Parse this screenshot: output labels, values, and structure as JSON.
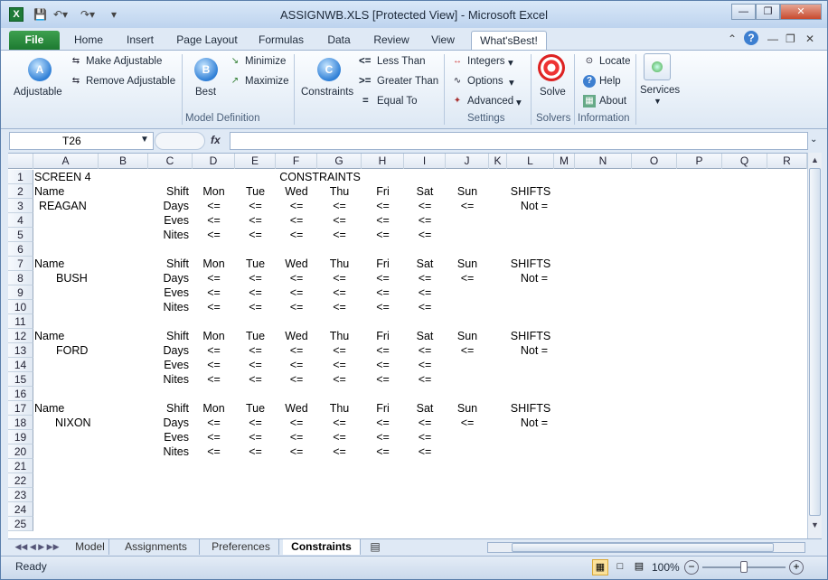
{
  "window": {
    "title": "ASSIGNWB.XLS  [Protected View]  -  Microsoft Excel",
    "app_icon": "X"
  },
  "quick_access": {
    "save": "save-icon",
    "undo": "undo-icon",
    "redo": "redo-icon"
  },
  "tabs": [
    "File",
    "Home",
    "Insert",
    "Page Layout",
    "Formulas",
    "Data",
    "Review",
    "View",
    "What'sBest!"
  ],
  "ribbon": {
    "adjustable": "Adjustable",
    "make_adjustable": "Make Adjustable",
    "remove_adjustable": "Remove Adjustable",
    "best": "Best",
    "minimize": "Minimize",
    "maximize": "Maximize",
    "constraints": "Constraints",
    "less_than": "Less Than",
    "greater_than": "Greater Than",
    "equal_to": "Equal To",
    "integers": "Integers",
    "options": "Options",
    "advanced": "Advanced",
    "solve": "Solve",
    "locate": "Locate",
    "help": "Help",
    "about": "About",
    "services": "Services",
    "groups": {
      "model_definition": "Model Definition",
      "settings": "Settings",
      "solvers": "Solvers",
      "information": "Information"
    },
    "glyphs": {
      "le": "<=",
      "ge": ">=",
      "eq": "="
    }
  },
  "formula_bar": {
    "name_box": "T26",
    "fx": "fx",
    "value": ""
  },
  "columns": [
    "A",
    "B",
    "C",
    "D",
    "E",
    "F",
    "G",
    "H",
    "I",
    "J",
    "K",
    "L",
    "M",
    "N",
    "O",
    "P",
    "Q",
    "R"
  ],
  "rows": [
    "1",
    "2",
    "3",
    "4",
    "5",
    "6",
    "7",
    "8",
    "9",
    "10",
    "11",
    "12",
    "13",
    "14",
    "15",
    "16",
    "17",
    "18",
    "19",
    "20",
    "21",
    "22",
    "23",
    "24",
    "25"
  ],
  "cells": {
    "A1": "SCREEN 4",
    "F1": "CONSTRAINTS",
    "A2": "Name",
    "C2": "Shift",
    "D2": "Mon",
    "E2": "Tue",
    "F2": "Wed",
    "G2": "Thu",
    "H2": "Fri",
    "I2": "Sat",
    "J2": "Sun",
    "L2": "SHIFTS",
    "A3": "REAGAN",
    "C3": "Days",
    "D3": "<=",
    "E3": "<=",
    "F3": "<=",
    "G3": "<=",
    "H3": "<=",
    "I3": "<=",
    "J3": "<=",
    "L3": "Not =",
    "C4": "Eves",
    "D4": "<=",
    "E4": "<=",
    "F4": "<=",
    "G4": "<=",
    "H4": "<=",
    "I4": "<=",
    "C5": "Nites",
    "D5": "<=",
    "E5": "<=",
    "F5": "<=",
    "G5": "<=",
    "H5": "<=",
    "I5": "<=",
    "A7": "Name",
    "C7": "Shift",
    "D7": "Mon",
    "E7": "Tue",
    "F7": "Wed",
    "G7": "Thu",
    "H7": "Fri",
    "I7": "Sat",
    "J7": "Sun",
    "L7": "SHIFTS",
    "A8": "BUSH",
    "C8": "Days",
    "D8": "<=",
    "E8": "<=",
    "F8": "<=",
    "G8": "<=",
    "H8": "<=",
    "I8": "<=",
    "J8": "<=",
    "L8": "Not =",
    "C9": "Eves",
    "D9": "<=",
    "E9": "<=",
    "F9": "<=",
    "G9": "<=",
    "H9": "<=",
    "I9": "<=",
    "C10": "Nites",
    "D10": "<=",
    "E10": "<=",
    "F10": "<=",
    "G10": "<=",
    "H10": "<=",
    "I10": "<=",
    "A12": "Name",
    "C12": "Shift",
    "D12": "Mon",
    "E12": "Tue",
    "F12": "Wed",
    "G12": "Thu",
    "H12": "Fri",
    "I12": "Sat",
    "J12": "Sun",
    "L12": "SHIFTS",
    "A13": "FORD",
    "C13": "Days",
    "D13": "<=",
    "E13": "<=",
    "F13": "<=",
    "G13": "<=",
    "H13": "<=",
    "I13": "<=",
    "J13": "<=",
    "L13": "Not =",
    "C14": "Eves",
    "D14": "<=",
    "E14": "<=",
    "F14": "<=",
    "G14": "<=",
    "H14": "<=",
    "I14": "<=",
    "C15": "Nites",
    "D15": "<=",
    "E15": "<=",
    "F15": "<=",
    "G15": "<=",
    "H15": "<=",
    "I15": "<=",
    "A17": "Name",
    "C17": "Shift",
    "D17": "Mon",
    "E17": "Tue",
    "F17": "Wed",
    "G17": "Thu",
    "H17": "Fri",
    "I17": "Sat",
    "J17": "Sun",
    "L17": "SHIFTS",
    "A18": "NIXON",
    "C18": "Days",
    "D18": "<=",
    "E18": "<=",
    "F18": "<=",
    "G18": "<=",
    "H18": "<=",
    "I18": "<=",
    "J18": "<=",
    "L18": "Not =",
    "C19": "Eves",
    "D19": "<=",
    "E19": "<=",
    "F19": "<=",
    "G19": "<=",
    "H19": "<=",
    "I19": "<=",
    "C20": "Nites",
    "D20": "<=",
    "E20": "<=",
    "F20": "<=",
    "G20": "<=",
    "H20": "<=",
    "I20": "<="
  },
  "sheets": [
    "Model",
    "Assignments",
    "Preferences",
    "Constraints"
  ],
  "active_sheet": "Constraints",
  "status": {
    "ready": "Ready",
    "zoom": "100%"
  }
}
